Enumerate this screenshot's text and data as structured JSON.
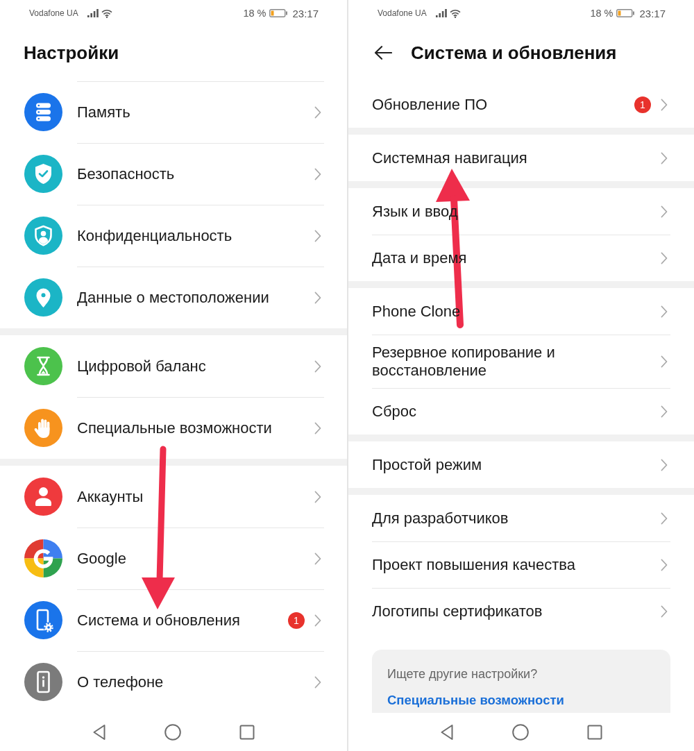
{
  "screens": [
    {
      "kind": "main",
      "status_bar": {
        "carrier": "Vodafone UA",
        "battery": "18 %",
        "time": "23:17"
      },
      "title": "Настройки",
      "groups": [
        {
          "items": [
            {
              "label": "Память"
            },
            {
              "label": "Безопасность"
            },
            {
              "label": "Конфиденциальность"
            },
            {
              "label": "Данные о местоположении"
            }
          ]
        },
        {
          "items": [
            {
              "label": "Цифровой баланс"
            },
            {
              "label": "Специальные возможности"
            }
          ]
        },
        {
          "items": [
            {
              "label": "Аккаунты"
            },
            {
              "label": "Google"
            },
            {
              "label": "Система и обновления",
              "badge": "1"
            },
            {
              "label": "О телефоне"
            }
          ]
        }
      ]
    },
    {
      "kind": "sub",
      "status_bar": {
        "carrier": "Vodafone UA",
        "battery": "18 %",
        "time": "23:17"
      },
      "title": "Система и обновления",
      "groups": [
        {
          "items": [
            {
              "label": "Обновление ПО",
              "badge": "1"
            }
          ]
        },
        {
          "items": [
            {
              "label": "Системная навигация"
            }
          ]
        },
        {
          "items": [
            {
              "label": "Язык и ввод"
            },
            {
              "label": "Дата и время"
            }
          ]
        },
        {
          "items": [
            {
              "label": "Phone Clone"
            },
            {
              "label": "Резервное копирование и восстановление"
            },
            {
              "label": "Сброс"
            }
          ]
        },
        {
          "items": [
            {
              "label": "Простой режим"
            }
          ]
        },
        {
          "items": [
            {
              "label": "Для разработчиков"
            },
            {
              "label": "Проект повышения качества"
            },
            {
              "label": "Логотипы сертификатов"
            }
          ]
        }
      ],
      "suggestion": {
        "prompt": "Ищете другие настройки?",
        "link": "Специальные возможности"
      }
    }
  ]
}
